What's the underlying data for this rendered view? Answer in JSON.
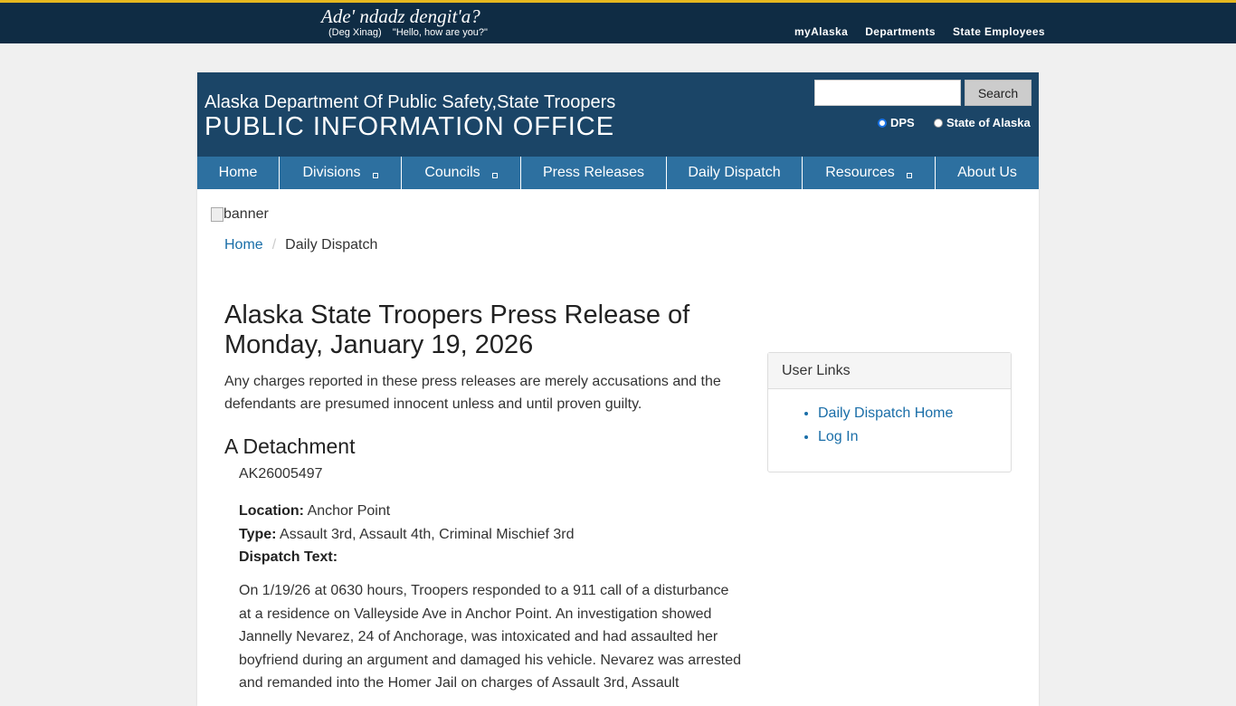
{
  "state_bar": {
    "greeting": "Ade' ndadz dengit'a?",
    "greeting_sub": "(Deg Xinag)    \"Hello, how are you?\"",
    "links": [
      "myAlaska",
      "Departments",
      "State Employees"
    ]
  },
  "header": {
    "line1": "Alaska Department Of Public Safety,State Troopers",
    "line2": "PUBLIC INFORMATION OFFICE",
    "search_button": "Search",
    "search_value": "",
    "radio_dps": "DPS",
    "radio_state": "State of Alaska"
  },
  "nav": {
    "items": [
      "Home",
      "Divisions",
      "Councils",
      "Press Releases",
      "Daily Dispatch",
      "Resources",
      "About Us"
    ]
  },
  "banner_alt": "banner",
  "breadcrumb": {
    "home": "Home",
    "current": "Daily Dispatch"
  },
  "main": {
    "title": "Alaska State Troopers Press Release of Monday, January 19, 2026",
    "disclaimer": "Any charges reported in these press releases are merely accusations and the defendants are presumed innocent unless and until proven guilty.",
    "detachment": "A Detachment",
    "case_number": "AK26005497",
    "location_label": "Location:",
    "location": "Anchor Point",
    "type_label": "Type:",
    "type": "Assault 3rd, Assault 4th, Criminal Mischief 3rd",
    "dispatch_label": "Dispatch Text:",
    "dispatch_text": "On 1/19/26 at 0630 hours, Troopers responded to a 911 call of a disturbance at a residence on Valleyside Ave in Anchor Point. An investigation showed Jannelly Nevarez, 24 of Anchorage, was intoxicated and had assaulted her boyfriend during an argument and damaged his vehicle. Nevarez was arrested and remanded into the Homer Jail on charges of Assault 3rd, Assault"
  },
  "sidebar": {
    "heading": "User Links",
    "links": [
      "Daily Dispatch Home",
      "Log In"
    ]
  },
  "colors": {
    "state_bar": "#0f2c44",
    "accent_gold": "#e5b81f",
    "header": "#1b4567",
    "nav": "#2d70a0",
    "link": "#1a6ea8"
  }
}
